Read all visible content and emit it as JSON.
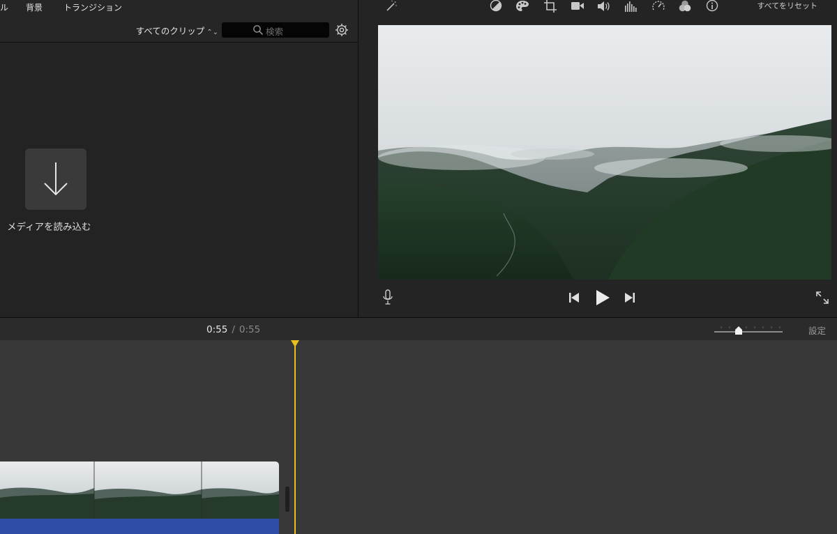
{
  "browser": {
    "top_tabs": [
      "ル",
      "背景",
      "トランジション"
    ],
    "clip_filter": "すべてのクリップ",
    "search_placeholder": "検索",
    "import_label": "メディアを読み込む"
  },
  "viewer": {
    "toolbar_icons": [
      "magic-wand-icon",
      "color-balance-icon",
      "color-palette-icon",
      "crop-icon",
      "stabilization-camera-icon",
      "volume-icon",
      "equalizer-icon",
      "speed-icon",
      "clip-filter-icon",
      "info-icon"
    ],
    "reset_label": "すべてをリセット"
  },
  "timeline": {
    "time_current": "0:55",
    "time_separator": "/",
    "time_total": "0:55",
    "settings_label": "設定"
  },
  "colors": {
    "playhead": "#e9c11a",
    "audio_track": "#2f4da6"
  }
}
